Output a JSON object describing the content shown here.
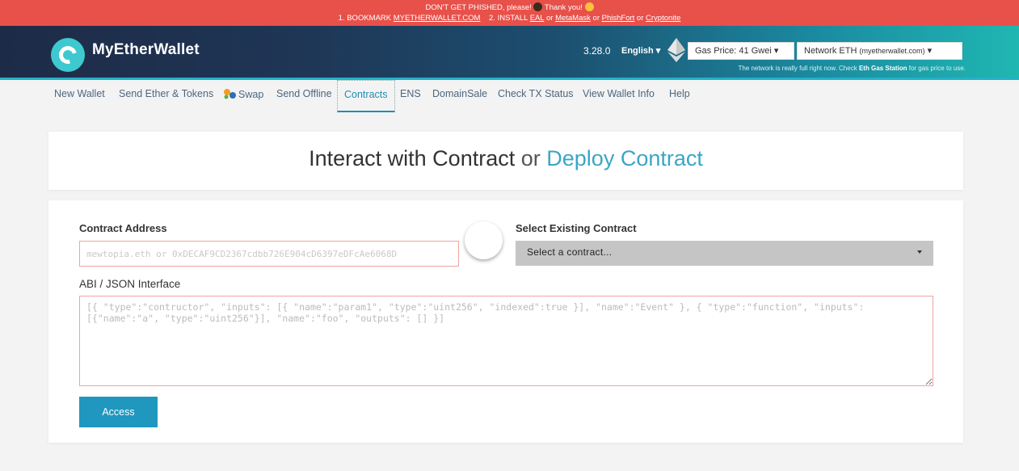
{
  "banner": {
    "line1_text": "DON'T GET PHISHED, please!",
    "line1_thanks": "Thank you!",
    "step1": "1. BOOKMARK",
    "step1_link": "MYETHERWALLET.COM",
    "step2": "2. INSTALL",
    "link_eal": "EAL",
    "or": "or",
    "link_metamask": "MetaMask",
    "link_phishfort": "PhishFort",
    "link_cryptonite": "Cryptonite"
  },
  "header": {
    "brand": "MyEtherWallet",
    "version": "3.28.0",
    "language": "English",
    "gas_price": "Gas Price: 41 Gwei",
    "network": "Network ETH",
    "network_host": "(myetherwallet.com)",
    "note_prefix": "The network is really full right now. Check",
    "note_link": "Eth Gas Station",
    "note_suffix": "for gas price to use."
  },
  "nav": {
    "new_wallet": "New Wallet",
    "send": "Send Ether & Tokens",
    "swap": "Swap",
    "send_offline": "Send Offline",
    "contracts": "Contracts",
    "ens": "ENS",
    "domainsale": "DomainSale",
    "check_tx": "Check TX Status",
    "view_wallet": "View Wallet Info",
    "help": "Help"
  },
  "title": {
    "interact": "Interact with Contract",
    "or": "or",
    "deploy": "Deploy Contract"
  },
  "form": {
    "contract_address_label": "Contract Address",
    "contract_address_placeholder": "mewtopia.eth or 0xDECAF9CD2367cdbb726E904cD6397eDFcAe6068D",
    "select_label": "Select Existing Contract",
    "select_value": "Select a contract...",
    "abi_label": "ABI / JSON Interface",
    "abi_placeholder": "[{ \"type\":\"contructor\", \"inputs\": [{ \"name\":\"param1\", \"type\":\"uint256\", \"indexed\":true }], \"name\":\"Event\" }, { \"type\":\"function\", \"inputs\": [{\"name\":\"a\", \"type\":\"uint256\"}], \"name\":\"foo\", \"outputs\": [] }]",
    "access_button": "Access"
  },
  "colors": {
    "banner": "#e8504a",
    "accent": "#1f97bf",
    "error_border": "#f0a3a3"
  }
}
